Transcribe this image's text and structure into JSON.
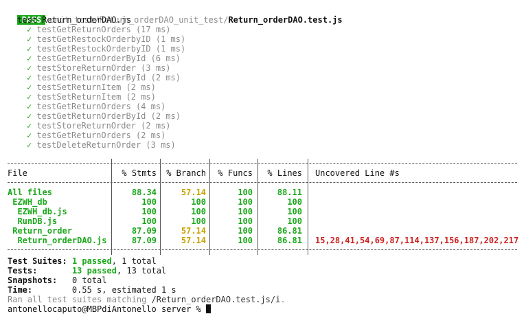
{
  "header": {
    "badge": "PASS",
    "path_dir": "unit_test/Return_orderDAO_unit_test/",
    "path_file": "Return_orderDAO.test.js"
  },
  "suite_title": "test Return_orderDAO.js",
  "tests": [
    "testGetReturnOrders (17 ms)",
    "testGetRestockOrderbyID (1 ms)",
    "testGetRestockOrderbyID (1 ms)",
    "testGetReturnOrderById (6 ms)",
    "testStoreReturnOrder (3 ms)",
    "testGetReturnOrderById (2 ms)",
    "testSetReturnItem (2 ms)",
    "testSetReturnItem (2 ms)",
    "testGetReturnOrders (4 ms)",
    "testGetReturnOrderById (2 ms)",
    "testStoreReturnOrder (2 ms)",
    "testGetReturnOrders (2 ms)",
    "testDeleteReturnOrder (3 ms)"
  ],
  "check_glyph": "✓",
  "table": {
    "headers": [
      "File",
      "% Stmts",
      "% Branch",
      "% Funcs",
      "% Lines",
      "Uncovered Line #s"
    ],
    "rows": [
      {
        "file": "All files",
        "stmts": "88.34",
        "branch": "57.14",
        "funcs": "100",
        "lines": "88.11",
        "uncovered": ""
      },
      {
        "file": " EZWH_db",
        "stmts": "100",
        "branch": "100",
        "funcs": "100",
        "lines": "100",
        "uncovered": ""
      },
      {
        "file": "  EZWH_db.js",
        "stmts": "100",
        "branch": "100",
        "funcs": "100",
        "lines": "100",
        "uncovered": ""
      },
      {
        "file": "  RunDB.js",
        "stmts": "100",
        "branch": "100",
        "funcs": "100",
        "lines": "100",
        "uncovered": ""
      },
      {
        "file": " Return_order",
        "stmts": "87.09",
        "branch": "57.14",
        "funcs": "100",
        "lines": "86.81",
        "uncovered": ""
      },
      {
        "file": "  Return_orderDAO.js",
        "stmts": "87.09",
        "branch": "57.14",
        "funcs": "100",
        "lines": "86.81",
        "uncovered": "15,28,41,54,69,87,114,137,156,187,202,217"
      }
    ]
  },
  "summary": {
    "suites_label": "Test Suites:",
    "suites_passed": "1 passed",
    "suites_total": ", 1 total",
    "tests_label": "Tests:",
    "tests_passed": "13 passed",
    "tests_total": ", 13 total",
    "snapshots_label": "Snapshots:",
    "snapshots_value": "0 total",
    "time_label": "Time:",
    "time_value": "0.55 s, estimated 1 s",
    "ran_prefix": "Ran all test suites matching ",
    "ran_pattern": "/Return_orderDAO.test.js/i",
    "ran_suffix": "."
  },
  "prompt": "antonellocaputo@MBPdiAntonello server % "
}
